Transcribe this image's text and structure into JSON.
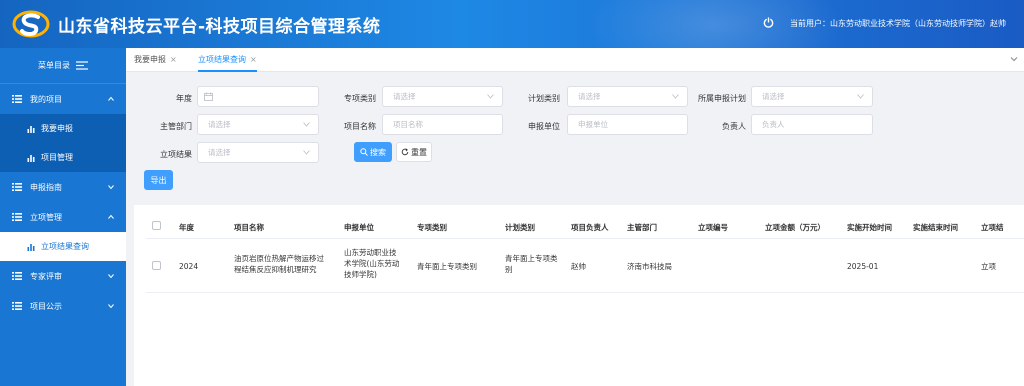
{
  "header": {
    "title": "山东省科技云平台-科技项目综合管理系统",
    "user_info": "当前用户：山东劳动职业技术学院（山东劳动技师学院）赵帅"
  },
  "sidebar": {
    "menu_label": "菜单目录",
    "groups": [
      {
        "label": "我的项目",
        "items": [
          {
            "label": "我要申报"
          },
          {
            "label": "项目管理"
          }
        ]
      },
      {
        "label": "申报指南"
      },
      {
        "label": "立项管理",
        "items": [
          {
            "label": "立项结果查询"
          }
        ]
      },
      {
        "label": "专家评审"
      },
      {
        "label": "项目公示"
      }
    ]
  },
  "tabs": [
    {
      "label": "我要申报",
      "close": "×"
    },
    {
      "label": "立项结果查询",
      "close": "×"
    }
  ],
  "filters": {
    "year": {
      "label": "年度",
      "placeholder": ""
    },
    "category": {
      "label": "专项类别",
      "placeholder": "请选择"
    },
    "plan_type": {
      "label": "计划类别",
      "placeholder": "请选择"
    },
    "plan": {
      "label": "所属申报计划",
      "placeholder": "请选择"
    },
    "dept": {
      "label": "主管部门",
      "placeholder": "请选择"
    },
    "name": {
      "label": "项目名称",
      "placeholder": "项目名称"
    },
    "unit": {
      "label": "申报单位",
      "placeholder": "申报单位"
    },
    "leader": {
      "label": "负责人",
      "placeholder": "负责人"
    },
    "result": {
      "label": "立项结果",
      "placeholder": "请选择"
    },
    "search_label": "搜索",
    "reset_label": "重置",
    "export_label": "导出"
  },
  "table": {
    "columns": [
      "年度",
      "项目名称",
      "申报单位",
      "专项类别",
      "计划类别",
      "项目负责人",
      "主管部门",
      "立项编号",
      "立项金额（万元）",
      "实施开始时间",
      "实施结束时间",
      "立项结"
    ],
    "rows": [
      {
        "year": "2024",
        "name_l1": "油页岩原位热解产物运移过",
        "name_l2": "程结焦反应抑制机理研究",
        "unit_l1": "山东劳动职业技",
        "unit_l2": "术学院(山东劳动",
        "unit_l3": "技师学院)",
        "category": "青年面上专项类别",
        "plan_l1": "青年面上专项类",
        "plan_l2": "别",
        "leader": "赵帅",
        "dept": "济南市科技局",
        "no": "",
        "amount": "",
        "start": "2025-01",
        "end": "",
        "result": "立项"
      }
    ]
  },
  "colors": {
    "header_bg": "#1976d2",
    "sidebar_bg": "#1976d2",
    "primary": "#409eff"
  }
}
